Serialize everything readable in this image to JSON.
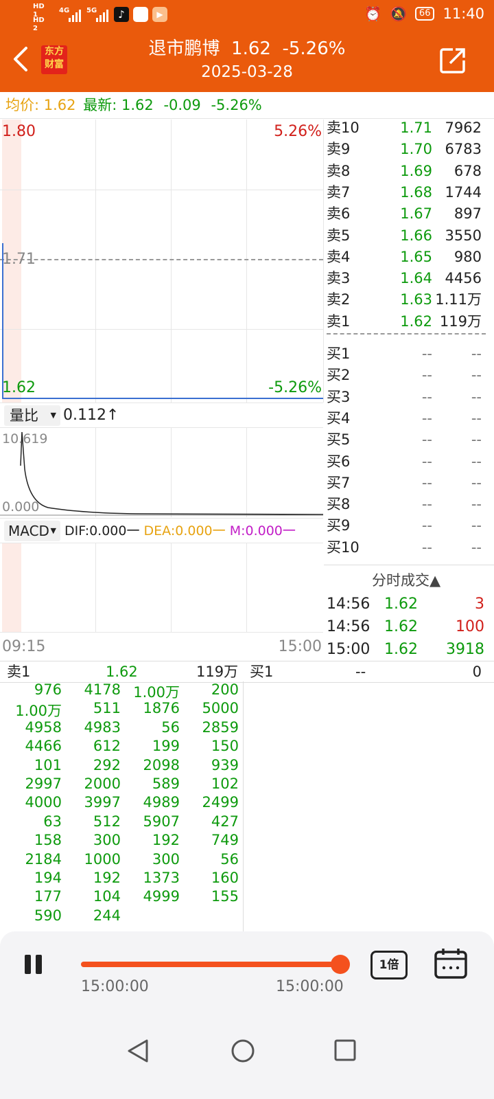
{
  "status": {
    "left_labels": [
      "HD 1",
      "HD 2"
    ],
    "net1": "4G",
    "net2": "5G",
    "battery": "66",
    "time": "11:40"
  },
  "header": {
    "logo_line1": "东方",
    "logo_line2": "财富",
    "title": "退市鹏博  1.62  -5.26%",
    "date": "2025-03-28"
  },
  "infobar": {
    "avg_label": "均价:",
    "avg_value": "1.62",
    "latest_label": "最新:",
    "latest_value": "1.62",
    "change": "-0.09",
    "change_pct": "-5.26%"
  },
  "price_chart": {
    "y_top": "1.80",
    "y_top_pct": "5.26%",
    "y_mid": "1.71",
    "y_bottom": "1.62",
    "y_bottom_pct": "-5.26%"
  },
  "volume_ratio": {
    "selector": "量比",
    "value": "0.112↑",
    "top": "10.619",
    "bottom": "0.000"
  },
  "macd": {
    "selector": "MACD",
    "dif": "DIF:0.000",
    "dea": "DEA:0.000",
    "m": "M:0.000"
  },
  "time_axis": {
    "start": "09:15",
    "end": "15:00"
  },
  "order_book": {
    "sells": [
      {
        "label": "卖10",
        "price": "1.71",
        "vol": "7962"
      },
      {
        "label": "卖9",
        "price": "1.70",
        "vol": "6783"
      },
      {
        "label": "卖8",
        "price": "1.69",
        "vol": "678"
      },
      {
        "label": "卖7",
        "price": "1.68",
        "vol": "1744"
      },
      {
        "label": "卖6",
        "price": "1.67",
        "vol": "897"
      },
      {
        "label": "卖5",
        "price": "1.66",
        "vol": "3550"
      },
      {
        "label": "卖4",
        "price": "1.65",
        "vol": "980"
      },
      {
        "label": "卖3",
        "price": "1.64",
        "vol": "4456"
      },
      {
        "label": "卖2",
        "price": "1.63",
        "vol": "1.11万"
      },
      {
        "label": "卖1",
        "price": "1.62",
        "vol": "119万"
      }
    ],
    "buys": [
      {
        "label": "买1",
        "price": "--",
        "vol": "--"
      },
      {
        "label": "买2",
        "price": "--",
        "vol": "--"
      },
      {
        "label": "买3",
        "price": "--",
        "vol": "--"
      },
      {
        "label": "买4",
        "price": "--",
        "vol": "--"
      },
      {
        "label": "买5",
        "price": "--",
        "vol": "--"
      },
      {
        "label": "买6",
        "price": "--",
        "vol": "--"
      },
      {
        "label": "买7",
        "price": "--",
        "vol": "--"
      },
      {
        "label": "买8",
        "price": "--",
        "vol": "--"
      },
      {
        "label": "买9",
        "price": "--",
        "vol": "--"
      },
      {
        "label": "买10",
        "price": "--",
        "vol": "--"
      }
    ]
  },
  "ticks": {
    "title": "分时成交▲",
    "rows": [
      {
        "time": "14:56",
        "price": "1.62",
        "vol": "3",
        "vol_color": "#d1201b"
      },
      {
        "time": "14:56",
        "price": "1.62",
        "vol": "100",
        "vol_color": "#d1201b"
      },
      {
        "time": "15:00",
        "price": "1.62",
        "vol": "3918",
        "vol_color": "#0d9a0d"
      }
    ]
  },
  "queue": {
    "sell_label": "卖1",
    "sell_price": "1.62",
    "sell_vol": "119万",
    "buy_label": "买1",
    "buy_price": "--",
    "buy_vol": "0",
    "orders": [
      [
        "976",
        "4178",
        "1.00万",
        "200"
      ],
      [
        "1.00万",
        "511",
        "1876",
        "5000"
      ],
      [
        "4958",
        "4983",
        "56",
        "2859"
      ],
      [
        "4466",
        "612",
        "199",
        "150"
      ],
      [
        "101",
        "292",
        "2098",
        "939"
      ],
      [
        "2997",
        "2000",
        "589",
        "102"
      ],
      [
        "4000",
        "3997",
        "4989",
        "2499"
      ],
      [
        "63",
        "512",
        "5907",
        "427"
      ],
      [
        "158",
        "300",
        "192",
        "749"
      ],
      [
        "2184",
        "1000",
        "300",
        "56"
      ],
      [
        "194",
        "192",
        "1373",
        "160"
      ],
      [
        "177",
        "104",
        "4999",
        "155"
      ],
      [
        "590",
        "244",
        "",
        ""
      ]
    ]
  },
  "player": {
    "progress": 1.0,
    "time_left": "15:00:00",
    "time_right": "15:00:00",
    "speed": "1倍"
  },
  "colors": {
    "brand": "#ea5a0c",
    "up": "#d1201b",
    "down": "#0d9a0d",
    "avg": "#e7a312",
    "slider": "#f4511e"
  }
}
